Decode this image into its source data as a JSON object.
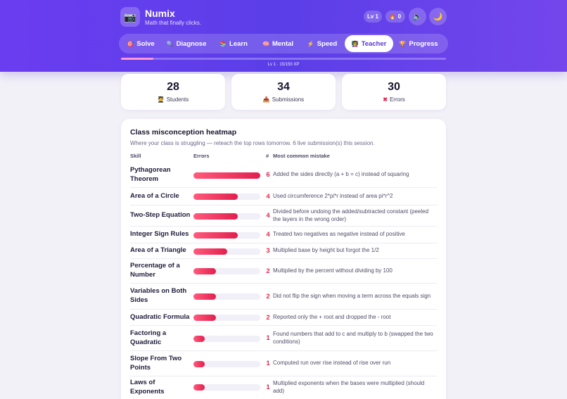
{
  "app": {
    "logo_icon": "camera-icon",
    "name": "Numix",
    "tagline": "Math that finally clicks."
  },
  "header": {
    "level_badge": "Lv 1",
    "streak_icon": "flame-icon",
    "streak_count": "0",
    "sound_icon": "speaker-icon",
    "theme_icon": "moon-icon"
  },
  "nav": {
    "tabs": [
      {
        "label": "Solve",
        "icon": "target-icon",
        "glyph": "🎯",
        "active": false
      },
      {
        "label": "Diagnose",
        "icon": "magnifier-icon",
        "glyph": "🔍",
        "active": false
      },
      {
        "label": "Learn",
        "icon": "books-icon",
        "glyph": "📚",
        "active": false
      },
      {
        "label": "Mental",
        "icon": "brain-icon",
        "glyph": "🧠",
        "active": false
      },
      {
        "label": "Speed",
        "icon": "lightning-icon",
        "glyph": "⚡",
        "active": false
      },
      {
        "label": "Teacher",
        "icon": "teacher-icon",
        "glyph": "👩‍🏫",
        "active": true
      },
      {
        "label": "Progress",
        "icon": "trophy-icon",
        "glyph": "🏆",
        "active": false
      }
    ]
  },
  "xp": {
    "label": "Lv 1 · 15/150 XP",
    "progress": 0.1
  },
  "stats": [
    {
      "value": "28",
      "label": "Students",
      "icon": "student-icon",
      "glyph": "🧑‍🎓",
      "color": "#8a5a1f"
    },
    {
      "value": "34",
      "label": "Submissions",
      "icon": "inbox-icon",
      "glyph": "📥",
      "color": "#3a6fd8"
    },
    {
      "value": "30",
      "label": "Errors",
      "icon": "cross-icon",
      "glyph": "✖",
      "color": "#e0284f"
    }
  ],
  "heatmap": {
    "title": "Class misconception heatmap",
    "subtitle": "Where your class is struggling — reteach the top rows tomorrow. 6 live submission(s) this session.",
    "columns": {
      "skill": "Skill",
      "errors": "Errors",
      "count": "#",
      "mistake": "Most common mistake"
    },
    "max_errors": 6,
    "rows": [
      {
        "skill": "Pythagorean Theorem",
        "errors": 6,
        "count": "6",
        "mistake": "Added the sides directly (a + b = c) instead of squaring"
      },
      {
        "skill": "Area of a Circle",
        "errors": 4,
        "count": "4",
        "mistake": "Used circumference 2*pi*r instead of area pi*r^2"
      },
      {
        "skill": "Two-Step Equation",
        "errors": 4,
        "count": "4",
        "mistake": "Divided before undoing the added/subtracted constant (peeled the layers in the wrong order)"
      },
      {
        "skill": "Integer Sign Rules",
        "errors": 4,
        "count": "4",
        "mistake": "Treated two negatives as negative instead of positive"
      },
      {
        "skill": "Area of a Triangle",
        "errors": 3,
        "count": "3",
        "mistake": "Multiplied base by height but forgot the 1/2"
      },
      {
        "skill": "Percentage of a Number",
        "errors": 2,
        "count": "2",
        "mistake": "Multiplied by the percent without dividing by 100"
      },
      {
        "skill": "Variables on Both Sides",
        "errors": 2,
        "count": "2",
        "mistake": "Did not flip the sign when moving a term across the equals sign"
      },
      {
        "skill": "Quadratic Formula",
        "errors": 2,
        "count": "2",
        "mistake": "Reported only the + root and dropped the - root"
      },
      {
        "skill": "Factoring a Quadratic",
        "errors": 1,
        "count": "1",
        "mistake": "Found numbers that add to c and multiply to b (swapped the two conditions)"
      },
      {
        "skill": "Slope From Two Points",
        "errors": 1,
        "count": "1",
        "mistake": "Computed run over rise instead of rise over run"
      },
      {
        "skill": "Laws of Exponents",
        "errors": 1,
        "count": "1",
        "mistake": "Multiplied exponents when the bases were multiplied (should add)"
      }
    ]
  },
  "colors": {
    "header": "#5b3ee8",
    "accent": "#e0284f",
    "active_tab_text": "#5a36d6"
  }
}
